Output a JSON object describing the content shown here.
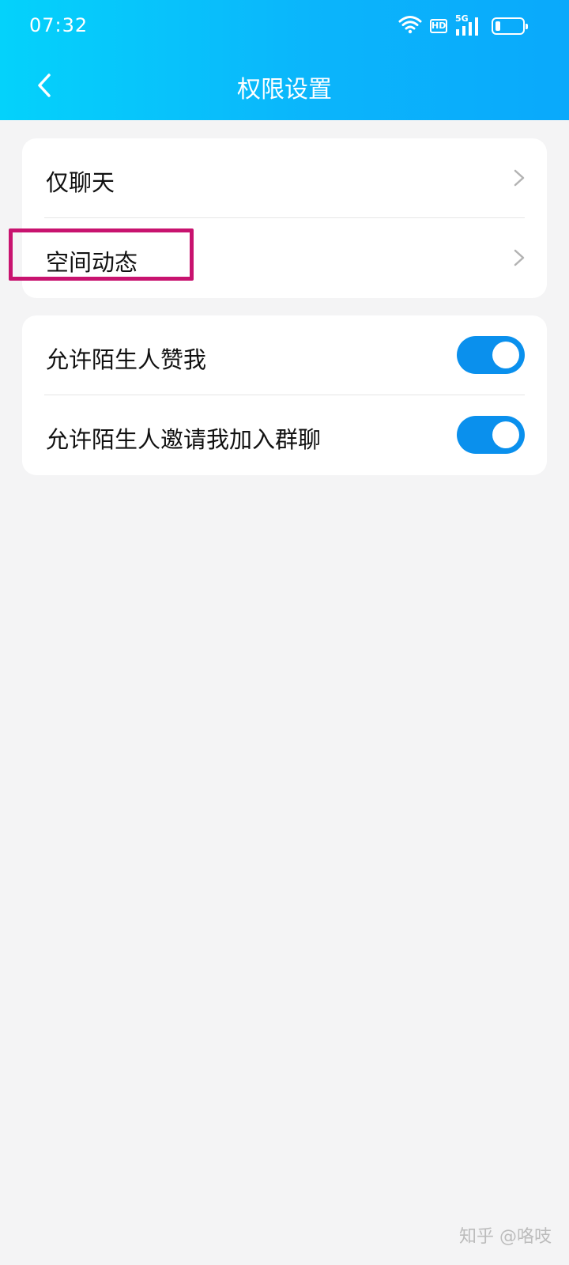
{
  "status_bar": {
    "time": "07:32",
    "hd_label": "HD",
    "network_label": "5G",
    "battery_level": 0.2
  },
  "nav": {
    "title": "权限设置",
    "back_icon": "chevron-left-icon"
  },
  "menu_items": [
    {
      "label": "仅聊天",
      "icon": "chevron-right-icon"
    },
    {
      "label": "空间动态",
      "icon": "chevron-right-icon",
      "highlighted": true
    }
  ],
  "toggle_items": [
    {
      "label": "允许陌生人赞我",
      "on": true
    },
    {
      "label": "允许陌生人邀请我加入群聊",
      "on": true
    }
  ],
  "colors": {
    "header_gradient_start": "#04d2fb",
    "header_gradient_end": "#0aa9fb",
    "toggle_on": "#0a90ed",
    "highlight": "#c8136f"
  },
  "watermark": "知乎 @咯吱"
}
